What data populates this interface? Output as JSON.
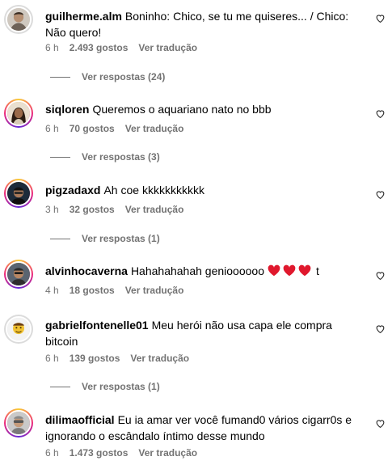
{
  "comments": [
    {
      "username": "guilherme.alm",
      "text": "Boninho: Chico, se tu me quiseres... / Chico: Não quero!",
      "time": "6 h",
      "likes": "2.493 gostos",
      "translate": "Ver tradução",
      "replies": "Ver respostas (24)"
    },
    {
      "username": "siqloren",
      "text": "Queremos o aquariano nato no bbb",
      "time": "6 h",
      "likes": "70 gostos",
      "translate": "Ver tradução",
      "replies": "Ver respostas (3)"
    },
    {
      "username": "pigzadaxd",
      "text": "Ah coe kkkkkkkkkkk",
      "time": "3 h",
      "likes": "32 gostos",
      "translate": "Ver tradução",
      "replies": "Ver respostas (1)"
    },
    {
      "username": "alvinhocaverna",
      "text": "Hahahahahah genioooooo",
      "text_suffix": "t",
      "time": "4 h",
      "likes": "18 gostos",
      "translate": "Ver tradução"
    },
    {
      "username": "gabrielfontenelle01",
      "text": "Meu herói não usa capa ele compra bitcoin",
      "time": "6 h",
      "likes": "139 gostos",
      "translate": "Ver tradução",
      "replies": "Ver respostas (1)"
    },
    {
      "username": "dilimaofficial",
      "text": "Eu ia amar ver você fumand0 vários cigarr0s e ignorando o escândalo íntimo desse mundo",
      "time": "6 h",
      "likes": "1.473 gostos",
      "translate": "Ver tradução"
    }
  ],
  "icons": {
    "like": "heart-outline-icon",
    "emoji": "red-heart-emoji"
  },
  "colors": {
    "meta": "#737373",
    "emoji_heart": "#e0182d"
  }
}
